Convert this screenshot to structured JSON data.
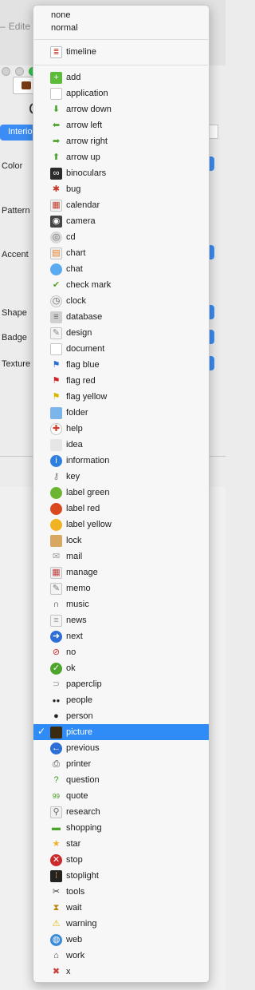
{
  "window": {
    "title": "Edite",
    "tab_label": "Interio",
    "heading_fragment": "C",
    "labels": {
      "color": "Color",
      "pattern": "Pattern",
      "accent": "Accent",
      "shape": "Shape",
      "badge": "Badge",
      "texture": "Texture"
    }
  },
  "menu": {
    "plain_items": [
      "none",
      "normal"
    ],
    "timeline": {
      "label": "timeline",
      "icon": "timeline-icon"
    },
    "selected": "picture",
    "items": [
      {
        "label": "add",
        "icon": "add-icon",
        "glyph": "+",
        "bg": "#5dbb3a",
        "fg": "#ffffff",
        "shape": "sq"
      },
      {
        "label": "application",
        "icon": "application-icon",
        "glyph": "",
        "bg": "#ffffff",
        "fg": "#888888",
        "shape": "sq"
      },
      {
        "label": "arrow down",
        "icon": "arrow-down-icon",
        "glyph": "⬇",
        "bg": "transparent",
        "fg": "#49a32b",
        "shape": "sq"
      },
      {
        "label": "arrow left",
        "icon": "arrow-left-icon",
        "glyph": "⬅",
        "bg": "transparent",
        "fg": "#49a32b",
        "shape": "sq"
      },
      {
        "label": "arrow right",
        "icon": "arrow-right-icon",
        "glyph": "➡",
        "bg": "transparent",
        "fg": "#49a32b",
        "shape": "sq"
      },
      {
        "label": "arrow up",
        "icon": "arrow-up-icon",
        "glyph": "⬆",
        "bg": "transparent",
        "fg": "#49a32b",
        "shape": "sq"
      },
      {
        "label": "binoculars",
        "icon": "binoculars-icon",
        "glyph": "∞",
        "bg": "#2b2b2b",
        "fg": "#ffffff",
        "shape": "sq"
      },
      {
        "label": "bug",
        "icon": "bug-icon",
        "glyph": "✱",
        "bg": "transparent",
        "fg": "#c0392b",
        "shape": "sq"
      },
      {
        "label": "calendar",
        "icon": "calendar-icon",
        "glyph": "▦",
        "bg": "#f4f4f4",
        "fg": "#c0392b",
        "shape": "sq"
      },
      {
        "label": "camera",
        "icon": "camera-icon",
        "glyph": "◉",
        "bg": "#444444",
        "fg": "#ffffff",
        "shape": "sq"
      },
      {
        "label": "cd",
        "icon": "cd-icon",
        "glyph": "◎",
        "bg": "#d8d8d8",
        "fg": "#777777",
        "shape": "round"
      },
      {
        "label": "chart",
        "icon": "chart-icon",
        "glyph": "▤",
        "bg": "#f0f0f0",
        "fg": "#e67e22",
        "shape": "sq"
      },
      {
        "label": "chat",
        "icon": "chat-icon",
        "glyph": "",
        "bg": "#5aaaf0",
        "fg": "#ffffff",
        "shape": "round"
      },
      {
        "label": "check mark",
        "icon": "check-mark-icon",
        "glyph": "✔",
        "bg": "transparent",
        "fg": "#5aa02c",
        "shape": "sq"
      },
      {
        "label": "clock",
        "icon": "clock-icon",
        "glyph": "◷",
        "bg": "#eeeeee",
        "fg": "#555555",
        "shape": "round"
      },
      {
        "label": "database",
        "icon": "database-icon",
        "glyph": "≡",
        "bg": "#cfcfcf",
        "fg": "#666666",
        "shape": "sq"
      },
      {
        "label": "design",
        "icon": "design-icon",
        "glyph": "✎",
        "bg": "#f4f4f4",
        "fg": "#888888",
        "shape": "sq"
      },
      {
        "label": "document",
        "icon": "document-icon",
        "glyph": "",
        "bg": "#ffffff",
        "fg": "#888888",
        "shape": "sq"
      },
      {
        "label": "flag blue",
        "icon": "flag-blue-icon",
        "glyph": "⚑",
        "bg": "transparent",
        "fg": "#2a6fd6",
        "shape": "sq"
      },
      {
        "label": "flag red",
        "icon": "flag-red-icon",
        "glyph": "⚑",
        "bg": "transparent",
        "fg": "#cc2222",
        "shape": "sq"
      },
      {
        "label": "flag yellow",
        "icon": "flag-yellow-icon",
        "glyph": "⚑",
        "bg": "transparent",
        "fg": "#d9b300",
        "shape": "sq"
      },
      {
        "label": "folder",
        "icon": "folder-icon",
        "glyph": "",
        "bg": "#7bb5ea",
        "fg": "#ffffff",
        "shape": "sq"
      },
      {
        "label": "help",
        "icon": "help-icon",
        "glyph": "✚",
        "bg": "#ffffff",
        "fg": "#d23b2b",
        "shape": "round"
      },
      {
        "label": "idea",
        "icon": "idea-icon",
        "glyph": "",
        "bg": "#e6e6e6",
        "fg": "#999999",
        "shape": "sq"
      },
      {
        "label": "information",
        "icon": "information-icon",
        "glyph": "i",
        "bg": "#2d7fe0",
        "fg": "#ffffff",
        "shape": "round"
      },
      {
        "label": "key",
        "icon": "key-icon",
        "glyph": "⚷",
        "bg": "transparent",
        "fg": "#888888",
        "shape": "sq"
      },
      {
        "label": "label green",
        "icon": "label-green-icon",
        "glyph": "",
        "bg": "#6bb533",
        "fg": "#ffffff",
        "shape": "round"
      },
      {
        "label": "label red",
        "icon": "label-red-icon",
        "glyph": "",
        "bg": "#d9481f",
        "fg": "#ffffff",
        "shape": "round"
      },
      {
        "label": "label yellow",
        "icon": "label-yellow-icon",
        "glyph": "",
        "bg": "#f2b323",
        "fg": "#ffffff",
        "shape": "round"
      },
      {
        "label": "lock",
        "icon": "lock-icon",
        "glyph": "",
        "bg": "#d9a860",
        "fg": "#ffffff",
        "shape": "sq"
      },
      {
        "label": "mail",
        "icon": "mail-icon",
        "glyph": "✉",
        "bg": "transparent",
        "fg": "#999999",
        "shape": "sq"
      },
      {
        "label": "manage",
        "icon": "manage-icon",
        "glyph": "▦",
        "bg": "#f0f0f0",
        "fg": "#c04040",
        "shape": "sq"
      },
      {
        "label": "memo",
        "icon": "memo-icon",
        "glyph": "✎",
        "bg": "#f4f4f4",
        "fg": "#777777",
        "shape": "sq"
      },
      {
        "label": "music",
        "icon": "music-icon",
        "glyph": "∩",
        "bg": "transparent",
        "fg": "#333333",
        "shape": "sq"
      },
      {
        "label": "news",
        "icon": "news-icon",
        "glyph": "≡",
        "bg": "#f4f4f4",
        "fg": "#999999",
        "shape": "sq"
      },
      {
        "label": "next",
        "icon": "next-icon",
        "glyph": "➜",
        "bg": "#2d6fd6",
        "fg": "#ffffff",
        "shape": "round"
      },
      {
        "label": "no",
        "icon": "no-icon",
        "glyph": "⊘",
        "bg": "transparent",
        "fg": "#cc2a2a",
        "shape": "round"
      },
      {
        "label": "ok",
        "icon": "ok-icon",
        "glyph": "✓",
        "bg": "#4da52e",
        "fg": "#ffffff",
        "shape": "round"
      },
      {
        "label": "paperclip",
        "icon": "paperclip-icon",
        "glyph": "⊃",
        "bg": "transparent",
        "fg": "#999999",
        "shape": "sq"
      },
      {
        "label": "people",
        "icon": "people-icon",
        "glyph": "●●",
        "bg": "transparent",
        "fg": "#222222",
        "shape": "sq"
      },
      {
        "label": "person",
        "icon": "person-icon",
        "glyph": "●",
        "bg": "transparent",
        "fg": "#222222",
        "shape": "sq"
      },
      {
        "label": "picture",
        "icon": "picture-icon",
        "glyph": "",
        "bg": "#3a2a10",
        "fg": "#f2b323",
        "shape": "sq"
      },
      {
        "label": "previous",
        "icon": "previous-icon",
        "glyph": "←",
        "bg": "#2d6fd6",
        "fg": "#ffffff",
        "shape": "round"
      },
      {
        "label": "printer",
        "icon": "printer-icon",
        "glyph": "⎙",
        "bg": "transparent",
        "fg": "#444444",
        "shape": "sq"
      },
      {
        "label": "question",
        "icon": "question-icon",
        "glyph": "?",
        "bg": "transparent",
        "fg": "#3d9a1e",
        "shape": "sq"
      },
      {
        "label": "quote",
        "icon": "quote-icon",
        "glyph": "99",
        "bg": "transparent",
        "fg": "#3d9a1e",
        "shape": "sq"
      },
      {
        "label": "research",
        "icon": "research-icon",
        "glyph": "⚲",
        "bg": "#f0f0f0",
        "fg": "#666666",
        "shape": "sq"
      },
      {
        "label": "shopping",
        "icon": "shopping-icon",
        "glyph": "▬",
        "bg": "transparent",
        "fg": "#4aa52a",
        "shape": "sq"
      },
      {
        "label": "star",
        "icon": "star-icon",
        "glyph": "★",
        "bg": "transparent",
        "fg": "#f0b020",
        "shape": "sq"
      },
      {
        "label": "stop",
        "icon": "stop-icon",
        "glyph": "✕",
        "bg": "#cc2a2a",
        "fg": "#ffffff",
        "shape": "round"
      },
      {
        "label": "stoplight",
        "icon": "stoplight-icon",
        "glyph": "⁞",
        "bg": "#222222",
        "fg": "#f0b020",
        "shape": "sq"
      },
      {
        "label": "tools",
        "icon": "tools-icon",
        "glyph": "✂",
        "bg": "transparent",
        "fg": "#333333",
        "shape": "sq"
      },
      {
        "label": "wait",
        "icon": "wait-icon",
        "glyph": "⧗",
        "bg": "transparent",
        "fg": "#b8860b",
        "shape": "sq"
      },
      {
        "label": "warning",
        "icon": "warning-icon",
        "glyph": "⚠",
        "bg": "transparent",
        "fg": "#e6b800",
        "shape": "sq"
      },
      {
        "label": "web",
        "icon": "web-icon",
        "glyph": "◍",
        "bg": "#3a8ad8",
        "fg": "#ffffff",
        "shape": "round"
      },
      {
        "label": "work",
        "icon": "work-icon",
        "glyph": "⌂",
        "bg": "transparent",
        "fg": "#444444",
        "shape": "sq"
      },
      {
        "label": "x",
        "icon": "x-icon",
        "glyph": "✖",
        "bg": "transparent",
        "fg": "#cc3b3b",
        "shape": "sq"
      }
    ]
  }
}
